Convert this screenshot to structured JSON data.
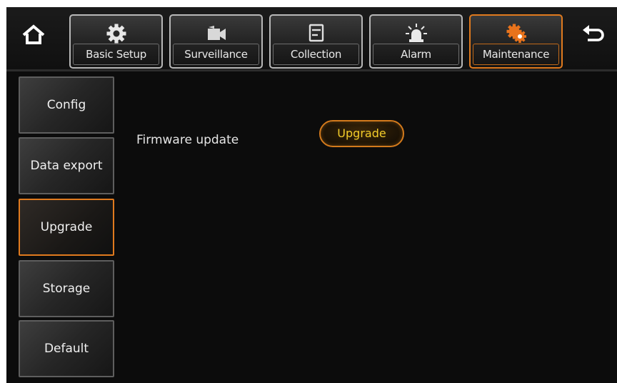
{
  "nav": {
    "tabs": [
      {
        "label": "Basic Setup",
        "icon": "gear-icon"
      },
      {
        "label": "Surveillance",
        "icon": "video-camera-icon"
      },
      {
        "label": "Collection",
        "icon": "form-icon"
      },
      {
        "label": "Alarm",
        "icon": "siren-icon"
      },
      {
        "label": "Maintenance",
        "icon": "maintenance-gears-icon",
        "active": true
      }
    ],
    "home_icon": "home-icon",
    "back_icon": "back-arrow-icon"
  },
  "sidebar": {
    "items": [
      {
        "label": "Config"
      },
      {
        "label": "Data export"
      },
      {
        "label": "Upgrade",
        "active": true
      },
      {
        "label": "Storage"
      },
      {
        "label": "Default"
      }
    ]
  },
  "main": {
    "firmware_label": "Firmware update",
    "upgrade_button": "Upgrade"
  },
  "colors": {
    "accent": "#e07a1e",
    "button_text": "#f3cc2a",
    "background": "#0c0c0c"
  }
}
